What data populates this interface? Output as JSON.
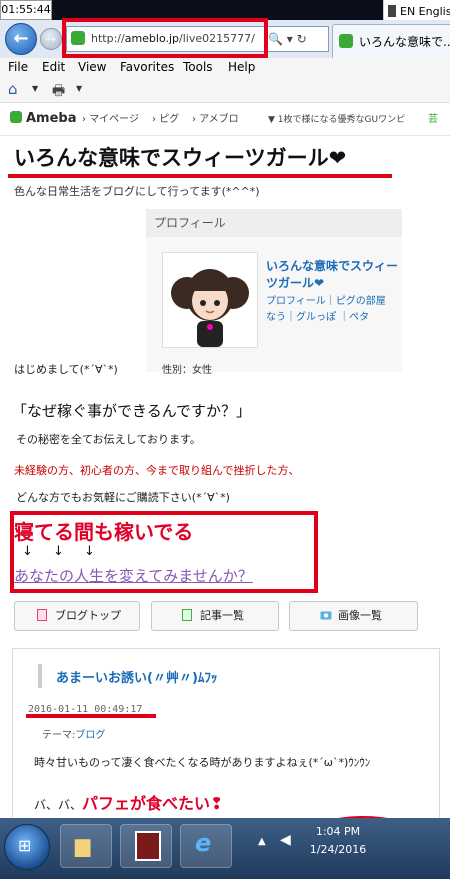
{
  "system": {
    "time_top": "01:55:44",
    "lang": "EN Englis",
    "taskbar_time": "1:04 PM",
    "taskbar_date": "1/24/2016"
  },
  "browser": {
    "url": "http://ameblo.jp/live0215777/",
    "url_prefix": "http://",
    "url_host": "ameblo.jp",
    "url_path": "/live0215777/",
    "addr_controls": "🔍 ▾ ↻",
    "tab_title": "いろんな意味で...",
    "menu": [
      "File",
      "Edit",
      "View",
      "Favorites",
      "Tools",
      "Help"
    ]
  },
  "ameba_bar": {
    "logo": "Ameba",
    "nav": [
      "マイページ",
      "ピグ",
      "アメブロ"
    ],
    "ad": "1枚で様になる優秀なGUワンピ",
    "extra": "芸"
  },
  "blog": {
    "title": "いろんな意味でスウィーツガール❤",
    "subtitle": "色んな日常生活をブログにして行ってます(*^^*)"
  },
  "profile": {
    "heading": "プロフィール",
    "name": "いろんな意味でスウィーツガール❤",
    "links": "プロフィール｜ピグの部屋 なう｜グルっぽ ｜ペタ",
    "gender": "性別：女性"
  },
  "greeting": "はじめまして(*´∀`*)",
  "ad": {
    "question": "「なぜ稼ぐ事ができるんですか？」",
    "line1": "その秘密を全てお伝えしております。",
    "line2": "未経験の方、初心者の方、今まで取り組んで挫折した方、",
    "line3": "どんな方でもお気軽にご購読下さい(*´∀`*)",
    "headline": "寝てる間も稼いでる",
    "arrows": "↓ ↓ ↓",
    "link": "あなたの人生を変えてみませんか？"
  },
  "buttons": {
    "blog_top": "ブログトップ",
    "articles": "記事一覧",
    "images": "画像一覧"
  },
  "entry": {
    "title": "あまーいお誘い(〃艸〃)ﾑﾌｯ",
    "date": "2016-01-11 00:49:17",
    "theme_label": "テーマ:",
    "theme_value": "ブログ",
    "body1": "時々甘いものって凄く食べたくなる時がありますよねぇ(*´ω`*)ｳﾝｳﾝ",
    "body2_prefix": "バ、バ、",
    "body2_emph": "パフェが食べたい❢"
  },
  "colors": {
    "annotation_red": "#e0001a",
    "link_blue": "#1b6bb5",
    "alert_red": "#cc0000",
    "link_purple": "#8a58b0"
  }
}
